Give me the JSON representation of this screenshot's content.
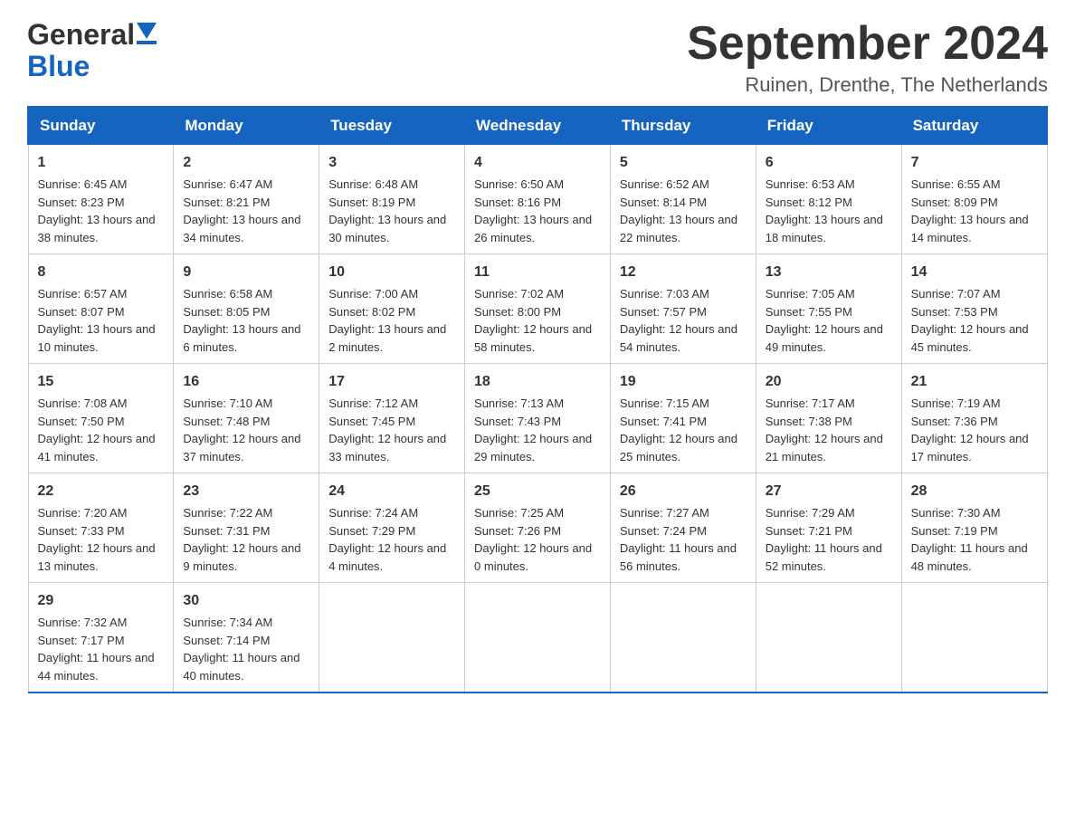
{
  "header": {
    "logo_general": "General",
    "logo_blue": "Blue",
    "title": "September 2024",
    "subtitle": "Ruinen, Drenthe, The Netherlands"
  },
  "days_of_week": [
    "Sunday",
    "Monday",
    "Tuesday",
    "Wednesday",
    "Thursday",
    "Friday",
    "Saturday"
  ],
  "weeks": [
    [
      {
        "day": "1",
        "sunrise": "6:45 AM",
        "sunset": "8:23 PM",
        "daylight": "13 hours and 38 minutes."
      },
      {
        "day": "2",
        "sunrise": "6:47 AM",
        "sunset": "8:21 PM",
        "daylight": "13 hours and 34 minutes."
      },
      {
        "day": "3",
        "sunrise": "6:48 AM",
        "sunset": "8:19 PM",
        "daylight": "13 hours and 30 minutes."
      },
      {
        "day": "4",
        "sunrise": "6:50 AM",
        "sunset": "8:16 PM",
        "daylight": "13 hours and 26 minutes."
      },
      {
        "day": "5",
        "sunrise": "6:52 AM",
        "sunset": "8:14 PM",
        "daylight": "13 hours and 22 minutes."
      },
      {
        "day": "6",
        "sunrise": "6:53 AM",
        "sunset": "8:12 PM",
        "daylight": "13 hours and 18 minutes."
      },
      {
        "day": "7",
        "sunrise": "6:55 AM",
        "sunset": "8:09 PM",
        "daylight": "13 hours and 14 minutes."
      }
    ],
    [
      {
        "day": "8",
        "sunrise": "6:57 AM",
        "sunset": "8:07 PM",
        "daylight": "13 hours and 10 minutes."
      },
      {
        "day": "9",
        "sunrise": "6:58 AM",
        "sunset": "8:05 PM",
        "daylight": "13 hours and 6 minutes."
      },
      {
        "day": "10",
        "sunrise": "7:00 AM",
        "sunset": "8:02 PM",
        "daylight": "13 hours and 2 minutes."
      },
      {
        "day": "11",
        "sunrise": "7:02 AM",
        "sunset": "8:00 PM",
        "daylight": "12 hours and 58 minutes."
      },
      {
        "day": "12",
        "sunrise": "7:03 AM",
        "sunset": "7:57 PM",
        "daylight": "12 hours and 54 minutes."
      },
      {
        "day": "13",
        "sunrise": "7:05 AM",
        "sunset": "7:55 PM",
        "daylight": "12 hours and 49 minutes."
      },
      {
        "day": "14",
        "sunrise": "7:07 AM",
        "sunset": "7:53 PM",
        "daylight": "12 hours and 45 minutes."
      }
    ],
    [
      {
        "day": "15",
        "sunrise": "7:08 AM",
        "sunset": "7:50 PM",
        "daylight": "12 hours and 41 minutes."
      },
      {
        "day": "16",
        "sunrise": "7:10 AM",
        "sunset": "7:48 PM",
        "daylight": "12 hours and 37 minutes."
      },
      {
        "day": "17",
        "sunrise": "7:12 AM",
        "sunset": "7:45 PM",
        "daylight": "12 hours and 33 minutes."
      },
      {
        "day": "18",
        "sunrise": "7:13 AM",
        "sunset": "7:43 PM",
        "daylight": "12 hours and 29 minutes."
      },
      {
        "day": "19",
        "sunrise": "7:15 AM",
        "sunset": "7:41 PM",
        "daylight": "12 hours and 25 minutes."
      },
      {
        "day": "20",
        "sunrise": "7:17 AM",
        "sunset": "7:38 PM",
        "daylight": "12 hours and 21 minutes."
      },
      {
        "day": "21",
        "sunrise": "7:19 AM",
        "sunset": "7:36 PM",
        "daylight": "12 hours and 17 minutes."
      }
    ],
    [
      {
        "day": "22",
        "sunrise": "7:20 AM",
        "sunset": "7:33 PM",
        "daylight": "12 hours and 13 minutes."
      },
      {
        "day": "23",
        "sunrise": "7:22 AM",
        "sunset": "7:31 PM",
        "daylight": "12 hours and 9 minutes."
      },
      {
        "day": "24",
        "sunrise": "7:24 AM",
        "sunset": "7:29 PM",
        "daylight": "12 hours and 4 minutes."
      },
      {
        "day": "25",
        "sunrise": "7:25 AM",
        "sunset": "7:26 PM",
        "daylight": "12 hours and 0 minutes."
      },
      {
        "day": "26",
        "sunrise": "7:27 AM",
        "sunset": "7:24 PM",
        "daylight": "11 hours and 56 minutes."
      },
      {
        "day": "27",
        "sunrise": "7:29 AM",
        "sunset": "7:21 PM",
        "daylight": "11 hours and 52 minutes."
      },
      {
        "day": "28",
        "sunrise": "7:30 AM",
        "sunset": "7:19 PM",
        "daylight": "11 hours and 48 minutes."
      }
    ],
    [
      {
        "day": "29",
        "sunrise": "7:32 AM",
        "sunset": "7:17 PM",
        "daylight": "11 hours and 44 minutes."
      },
      {
        "day": "30",
        "sunrise": "7:34 AM",
        "sunset": "7:14 PM",
        "daylight": "11 hours and 40 minutes."
      },
      null,
      null,
      null,
      null,
      null
    ]
  ],
  "labels": {
    "sunrise": "Sunrise:",
    "sunset": "Sunset:",
    "daylight": "Daylight:"
  }
}
